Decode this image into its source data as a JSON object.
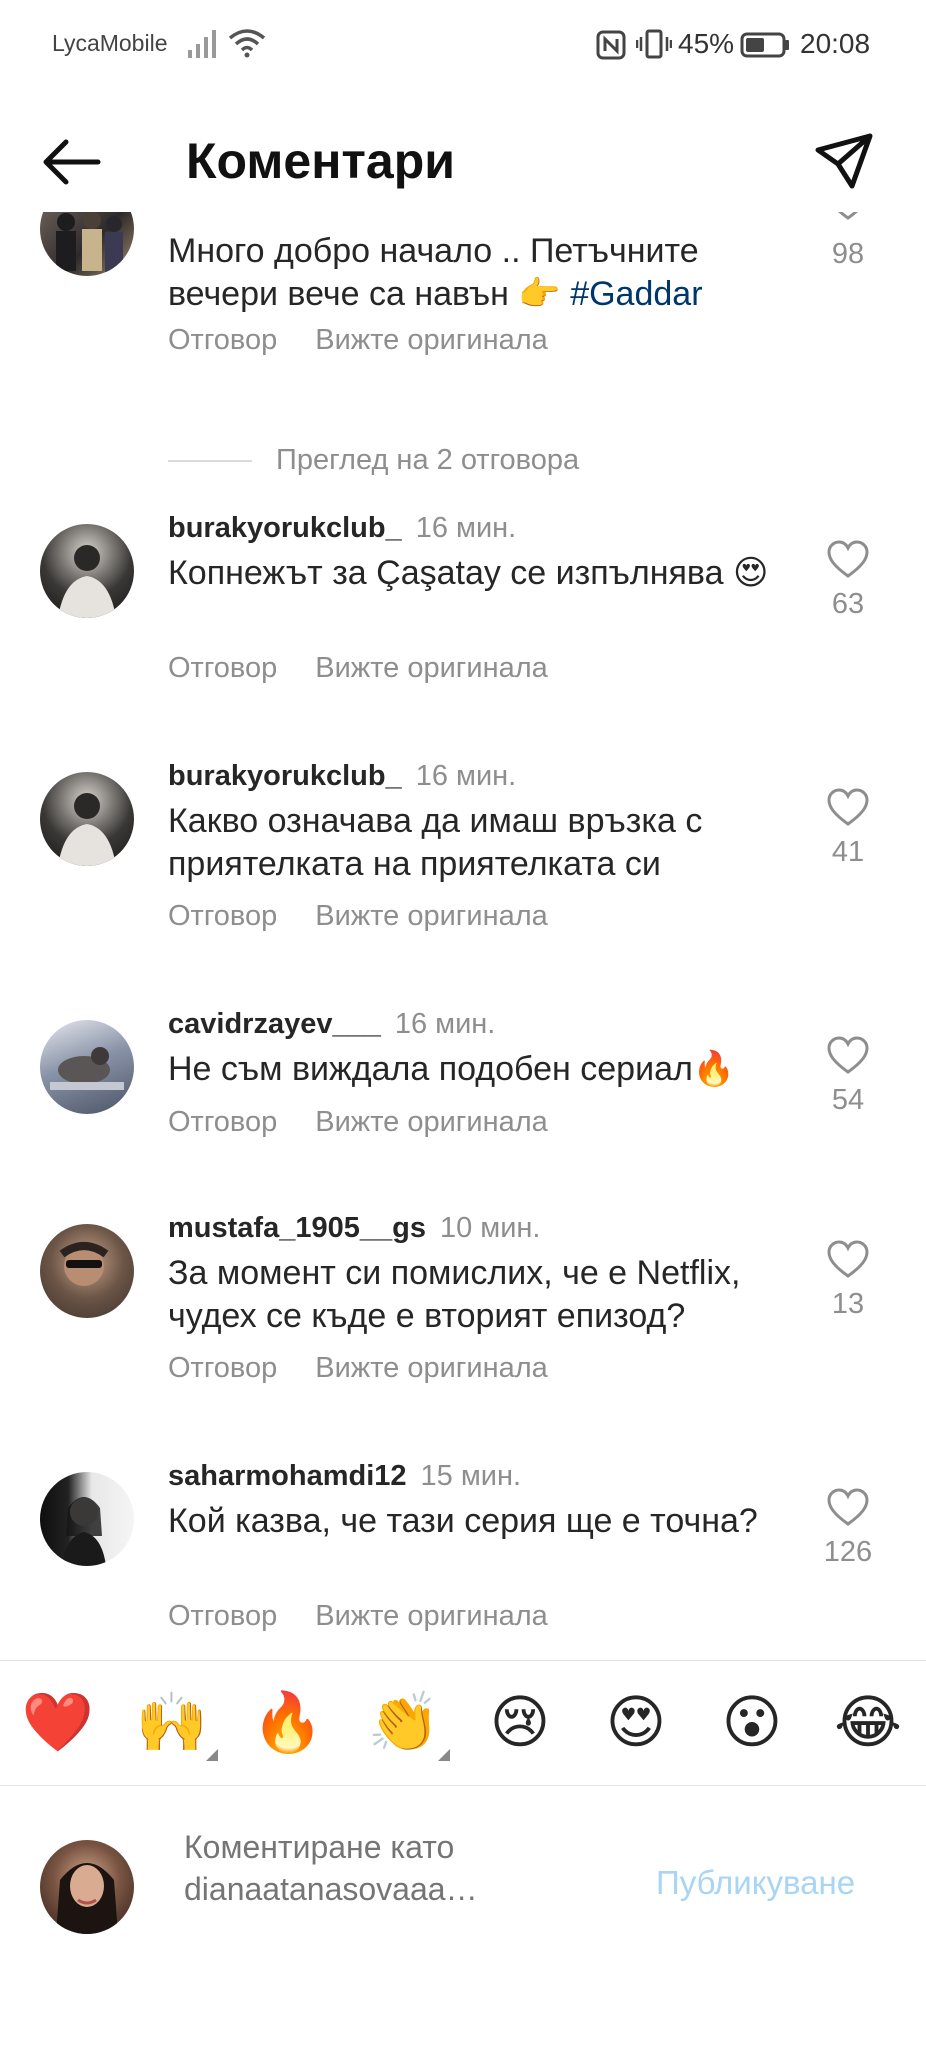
{
  "status_bar": {
    "carrier": "LycaMobile",
    "battery_percent": "45%",
    "time": "20:08"
  },
  "header": {
    "title": "Коментари"
  },
  "main_comment": {
    "text": "Много добро начало .. Петъчните вечери вече са навън 👉",
    "hashtag": "#Gaddar",
    "likes": "98",
    "reply_label": "Отговор",
    "original_label": "Вижте оригинала"
  },
  "replies_toggle": "Преглед на 2 отговора",
  "comments": [
    {
      "user": "burakyorukclub_",
      "time": "16 мин.",
      "text": "Копнежът за Çaşatay се изпълнява 😍",
      "likes": "63",
      "reply_label": "Отговор",
      "original_label": "Вижте оригинала"
    },
    {
      "user": "burakyorukclub_",
      "time": "16 мин.",
      "text": "Какво означава да имаш връзка с приятелката на приятелката си",
      "likes": "41",
      "reply_label": "Отговор",
      "original_label": "Вижте оригинала"
    },
    {
      "user": "cavidrzayev___",
      "time": "16 мин.",
      "text": "Не съм виждала подобен сериал🔥",
      "likes": "54",
      "reply_label": "Отговор",
      "original_label": "Вижте оригинала"
    },
    {
      "user": "mustafa_1905__gs",
      "time": "10 мин.",
      "text": "За момент си помислих, че е Netflix, чудех се къде е вторият епизод?",
      "likes": "13",
      "reply_label": "Отговор",
      "original_label": "Вижте оригинала"
    },
    {
      "user": "saharmohamdi12",
      "time": "15 мин.",
      "text": "Кой казва, че тази серия ще е точна?",
      "likes": "126",
      "reply_label": "Отговор",
      "original_label": "Вижте оригинала"
    }
  ],
  "emoji_bar": [
    "❤️",
    "🙌",
    "🔥",
    "👏",
    "😢",
    "😍",
    "😮",
    "😂"
  ],
  "composer": {
    "placeholder": "Коментиране като dianaatanasovaaa…",
    "post_label": "Публикуване"
  },
  "colors": {
    "text": "#262626",
    "secondary": "#8e8e8e",
    "hashtag": "#00376b",
    "post_disabled": "#a9d5f5"
  }
}
